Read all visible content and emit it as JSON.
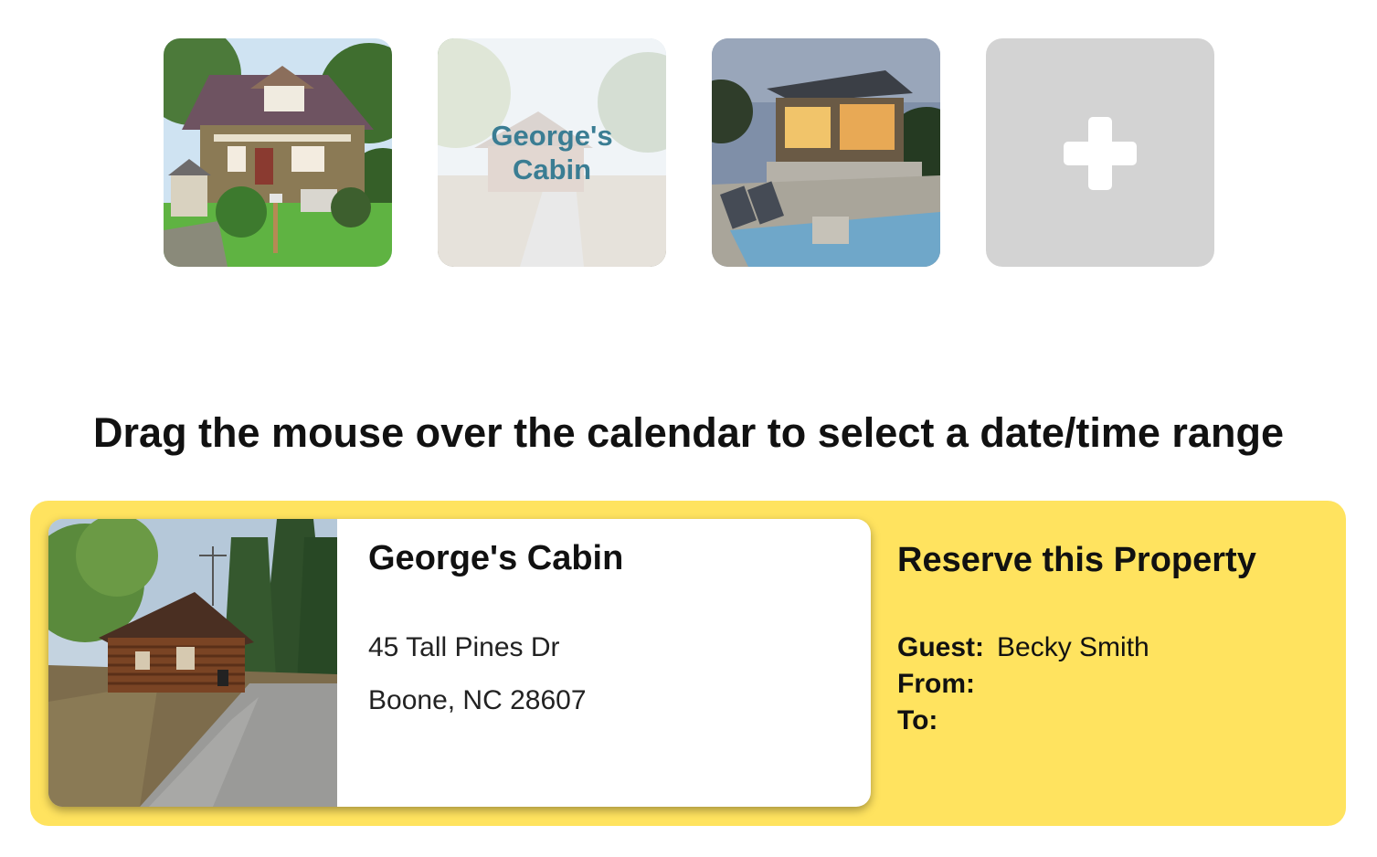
{
  "thumbnails": [
    {
      "name": "Craftsman house",
      "overlay_label": ""
    },
    {
      "name": "George's Cabin",
      "overlay_label": "George's Cabin"
    },
    {
      "name": "Modern pool house",
      "overlay_label": ""
    },
    {
      "name": "Add property",
      "icon": "plus-icon"
    }
  ],
  "instruction": "Drag the mouse over the calendar to select a date/time range",
  "property": {
    "name": "George's Cabin",
    "address_line1": "45 Tall Pines Dr",
    "address_line2": "Boone, NC 28607"
  },
  "reservation": {
    "title": "Reserve this Property",
    "guest_label": "Guest:",
    "guest_value": "Becky Smith",
    "from_label": "From:",
    "from_value": "",
    "to_label": "To:",
    "to_value": ""
  },
  "colors": {
    "panel_bg": "#ffe35f",
    "overlay_text": "#3a7d93",
    "add_tile_bg": "#d3d3d3"
  }
}
